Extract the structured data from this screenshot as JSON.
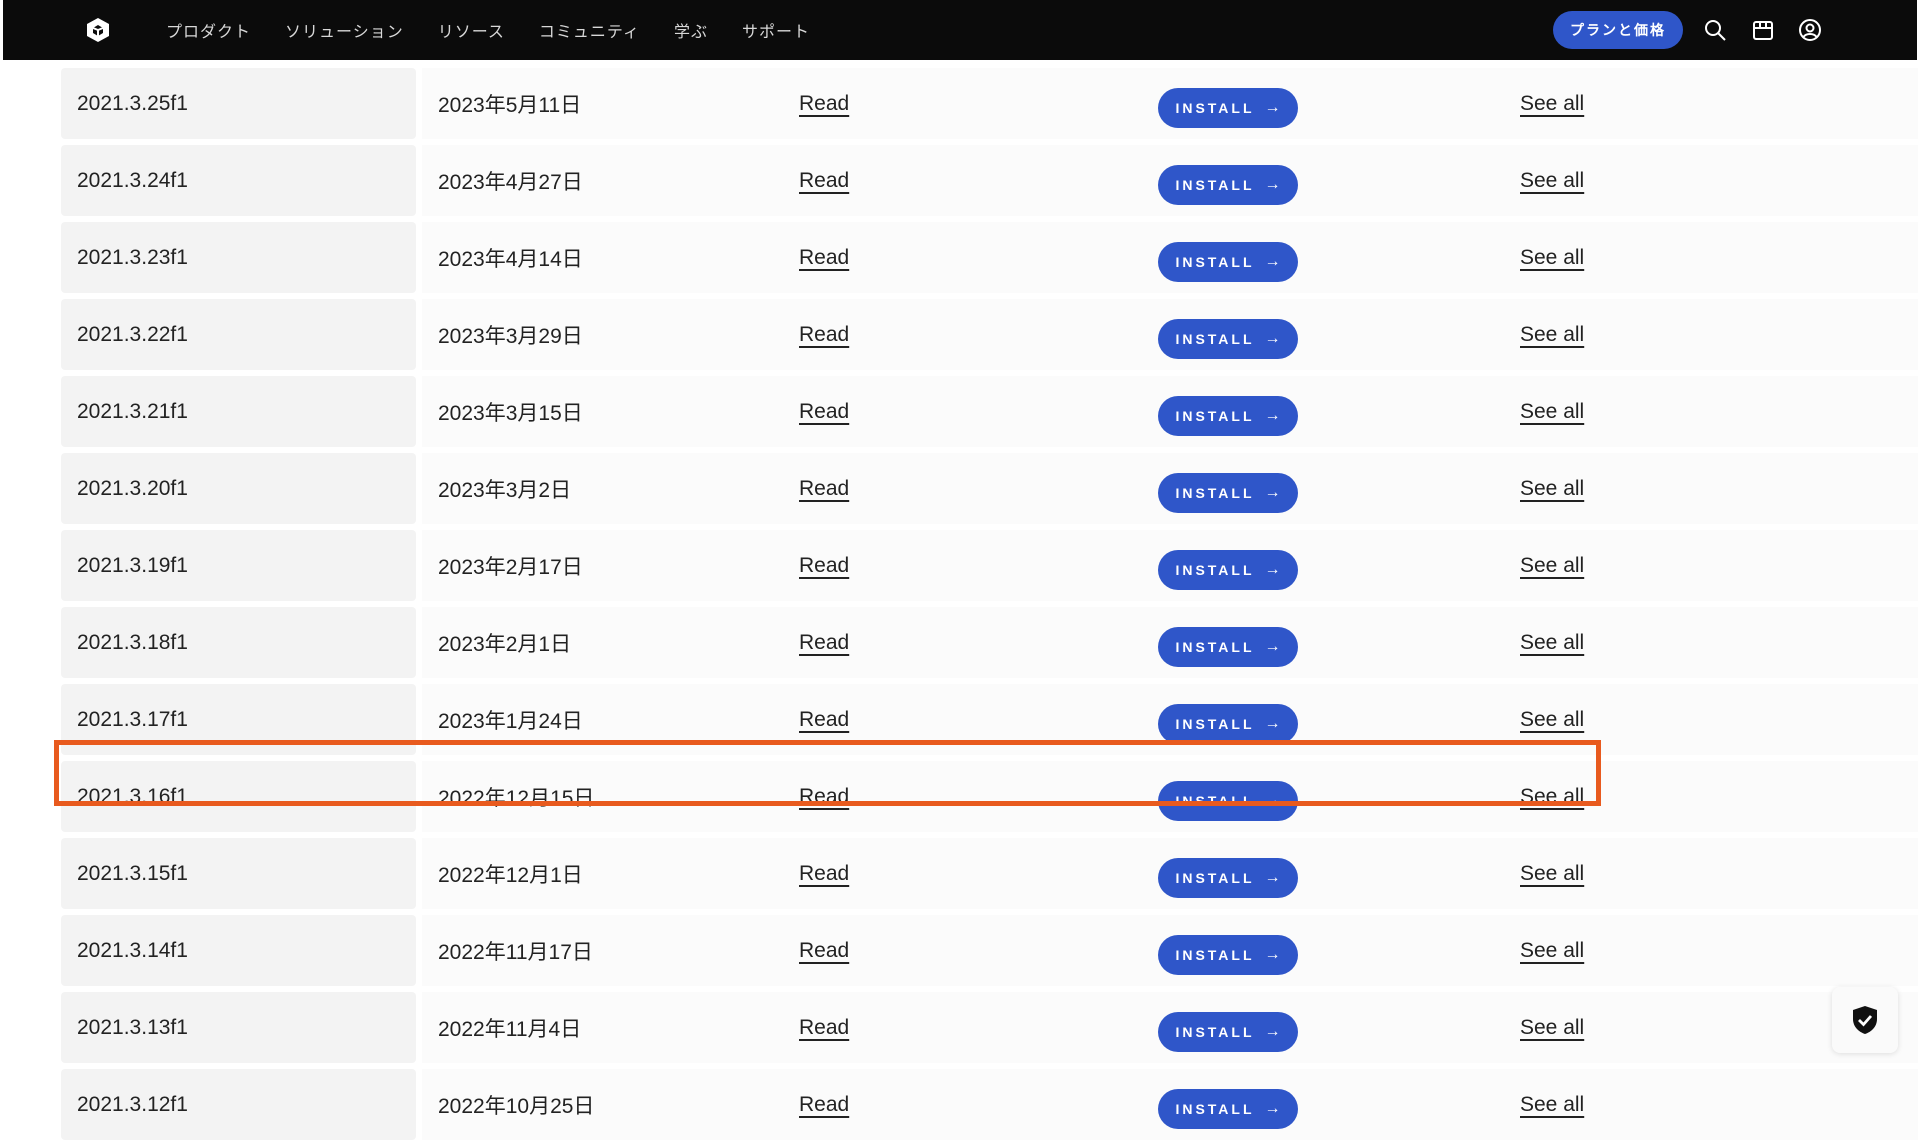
{
  "nav": {
    "items": [
      "プロダクト",
      "ソリューション",
      "リソース",
      "コミュニティ",
      "学ぶ",
      "サポート"
    ],
    "plan_button": "プランと価格",
    "icons": [
      "search-icon",
      "store-icon",
      "account-icon"
    ]
  },
  "rows": [
    {
      "version": "2021.3.25f1",
      "date": "2023年5月11日",
      "read": "Read",
      "install": "INSTALL",
      "see_all": "See all"
    },
    {
      "version": "2021.3.24f1",
      "date": "2023年4月27日",
      "read": "Read",
      "install": "INSTALL",
      "see_all": "See all"
    },
    {
      "version": "2021.3.23f1",
      "date": "2023年4月14日",
      "read": "Read",
      "install": "INSTALL",
      "see_all": "See all"
    },
    {
      "version": "2021.3.22f1",
      "date": "2023年3月29日",
      "read": "Read",
      "install": "INSTALL",
      "see_all": "See all"
    },
    {
      "version": "2021.3.21f1",
      "date": "2023年3月15日",
      "read": "Read",
      "install": "INSTALL",
      "see_all": "See all"
    },
    {
      "version": "2021.3.20f1",
      "date": "2023年3月2日",
      "read": "Read",
      "install": "INSTALL",
      "see_all": "See all"
    },
    {
      "version": "2021.3.19f1",
      "date": "2023年2月17日",
      "read": "Read",
      "install": "INSTALL",
      "see_all": "See all"
    },
    {
      "version": "2021.3.18f1",
      "date": "2023年2月1日",
      "read": "Read",
      "install": "INSTALL",
      "see_all": "See all"
    },
    {
      "version": "2021.3.17f1",
      "date": "2023年1月24日",
      "read": "Read",
      "install": "INSTALL",
      "see_all": "See all"
    },
    {
      "version": "2021.3.16f1",
      "date": "2022年12月15日",
      "read": "Read",
      "install": "INSTALL",
      "see_all": "See all"
    },
    {
      "version": "2021.3.15f1",
      "date": "2022年12月1日",
      "read": "Read",
      "install": "INSTALL",
      "see_all": "See all"
    },
    {
      "version": "2021.3.14f1",
      "date": "2022年11月17日",
      "read": "Read",
      "install": "INSTALL",
      "see_all": "See all"
    },
    {
      "version": "2021.3.13f1",
      "date": "2022年11月4日",
      "read": "Read",
      "install": "INSTALL",
      "see_all": "See all"
    },
    {
      "version": "2021.3.12f1",
      "date": "2022年10月25日",
      "read": "Read",
      "install": "INSTALL",
      "see_all": "See all"
    }
  ],
  "highlighted_version": "2021.3.16f1",
  "colors": {
    "nav_bg": "#0b0b0b",
    "accent_blue": "#2f56c9",
    "highlight_orange": "#e85a1e",
    "version_cell_bg": "#f3f3f3",
    "row_bg": "#fbfbfb"
  },
  "floating": {
    "icon": "shield-check-icon"
  }
}
